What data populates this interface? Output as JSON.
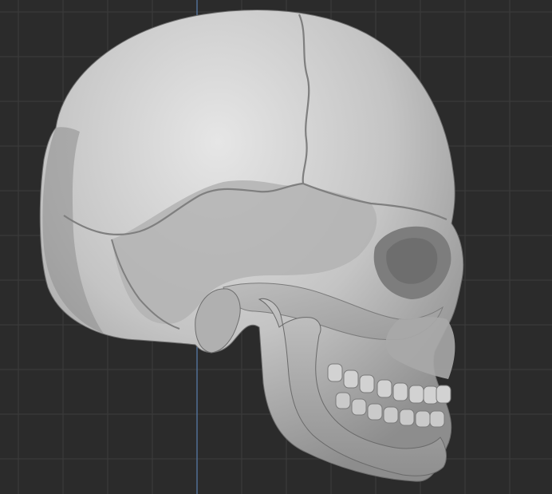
{
  "viewport": {
    "background_color": "#2b2b2b",
    "grid_color": "#3c3c3c",
    "vertical_axis_color": "#5a7fae",
    "model_color": "#c8c8c8"
  },
  "model": {
    "icon": "skull-model",
    "view": "right-side"
  }
}
